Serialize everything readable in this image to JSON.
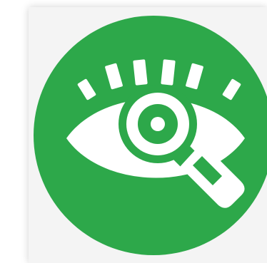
{
  "icon": {
    "name": "eye-magnifier-icon",
    "background_color": "#2da84a",
    "foreground_color": "#ffffff",
    "panel_color": "#f4f4f4"
  }
}
